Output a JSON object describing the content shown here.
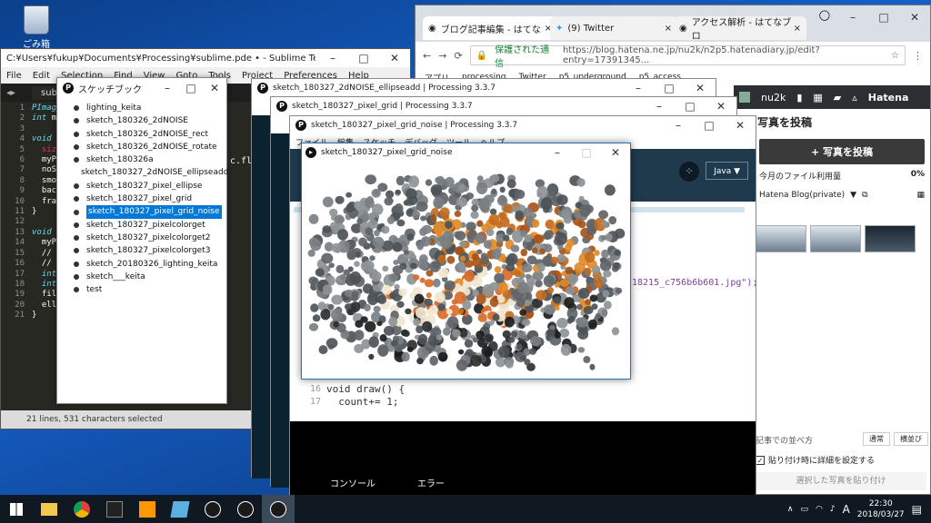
{
  "desktop": {
    "recycle_bin_label": "ごみ箱"
  },
  "sublime": {
    "title": "C:¥Users¥fukup¥Documents¥Processing¥sublime.pde • - Sublime Text (UNREGIS...",
    "menu": [
      "File",
      "Edit",
      "Selection",
      "Find",
      "View",
      "Goto",
      "Tools",
      "Project",
      "Preferences",
      "Help"
    ],
    "tab_label": "sub",
    "line_numbers": "1\n2\n3\n4\n5\n6\n7\n8\n9\n10\n11\n12\n13\n14\n15\n16\n17\n18\n19\n20\n21",
    "code_snippet": "c.fl",
    "status_text": "21 lines, 531 characters selected"
  },
  "sketchbook": {
    "title": "スケッチブック",
    "items": [
      "lighting_keita",
      "sketch_180326_2dNOISE",
      "sketch_180326_2dNOISE_rect",
      "sketch_180326_2dNOISE_rotate",
      "sketch_180326a",
      "sketch_180327_2dNOISE_ellipseadd",
      "sketch_180327_pixel_ellipse",
      "sketch_180327_pixel_grid",
      "sketch_180327_pixel_grid_noise",
      "sketch_180327_pixelcolorget",
      "sketch_180327_pixelcolorget2",
      "sketch_180327_pixelcolorget3",
      "sketch_20180326_lighting_keita",
      "sketch___keita",
      "test"
    ],
    "selected_index": 8
  },
  "chrome": {
    "tabs": [
      "ブログ記事編集 - はてな",
      "(9) Twitter",
      "アクセス解析 - はてなブロ"
    ],
    "secure_label": "保護された通信",
    "url": "https://blog.hatena.ne.jp/nu2k/n2p5.hatenadiary.jp/edit?entry=17391345...",
    "bookmarks": [
      "アプリ",
      "processing",
      "Twitter",
      "p5_underground",
      "p5_access"
    ],
    "hatena": {
      "user": "nu2k",
      "brand": "Hatena",
      "panel_title": "写真を投稿",
      "upload_button": "+ 写真を投稿",
      "usage_label": "今月のファイル利用量",
      "usage_value": "0%",
      "blog_select": "Hatena Blog(private)",
      "sort_label": "記事での並べ方",
      "sort_options": [
        "通常",
        "横並び"
      ],
      "detail_checkbox": "貼り付け時に詳細を設定する",
      "paste_button": "選択した写真を貼り付け"
    }
  },
  "processing": {
    "win1_title": "sketch_180327_2dNOISE_ellipseadd | Processing 3.3.7",
    "win2_title": "sketch_180327_pixel_grid | Processing 3.3.7",
    "win3_title": "sketch_180327_pixel_grid_noise | Processing 3.3.7",
    "win3_menu": [
      "ファイル",
      "編集",
      "スケッチ",
      "デバッグ",
      "ツール",
      "ヘルプ"
    ],
    "mode": "Java ▼",
    "editor_snippet": "18215_c756b6b601.jpg\");",
    "code_line_numbers": "16\n17",
    "code_lines": "void draw() {\n  count+= 1;",
    "console_tab": "コンソール",
    "errors_tab": "エラー"
  },
  "sketch_window": {
    "title": "sketch_180327_pixel_grid_noise"
  },
  "taskbar": {
    "ime": "A",
    "time": "22:30",
    "date": "2018/03/27"
  }
}
